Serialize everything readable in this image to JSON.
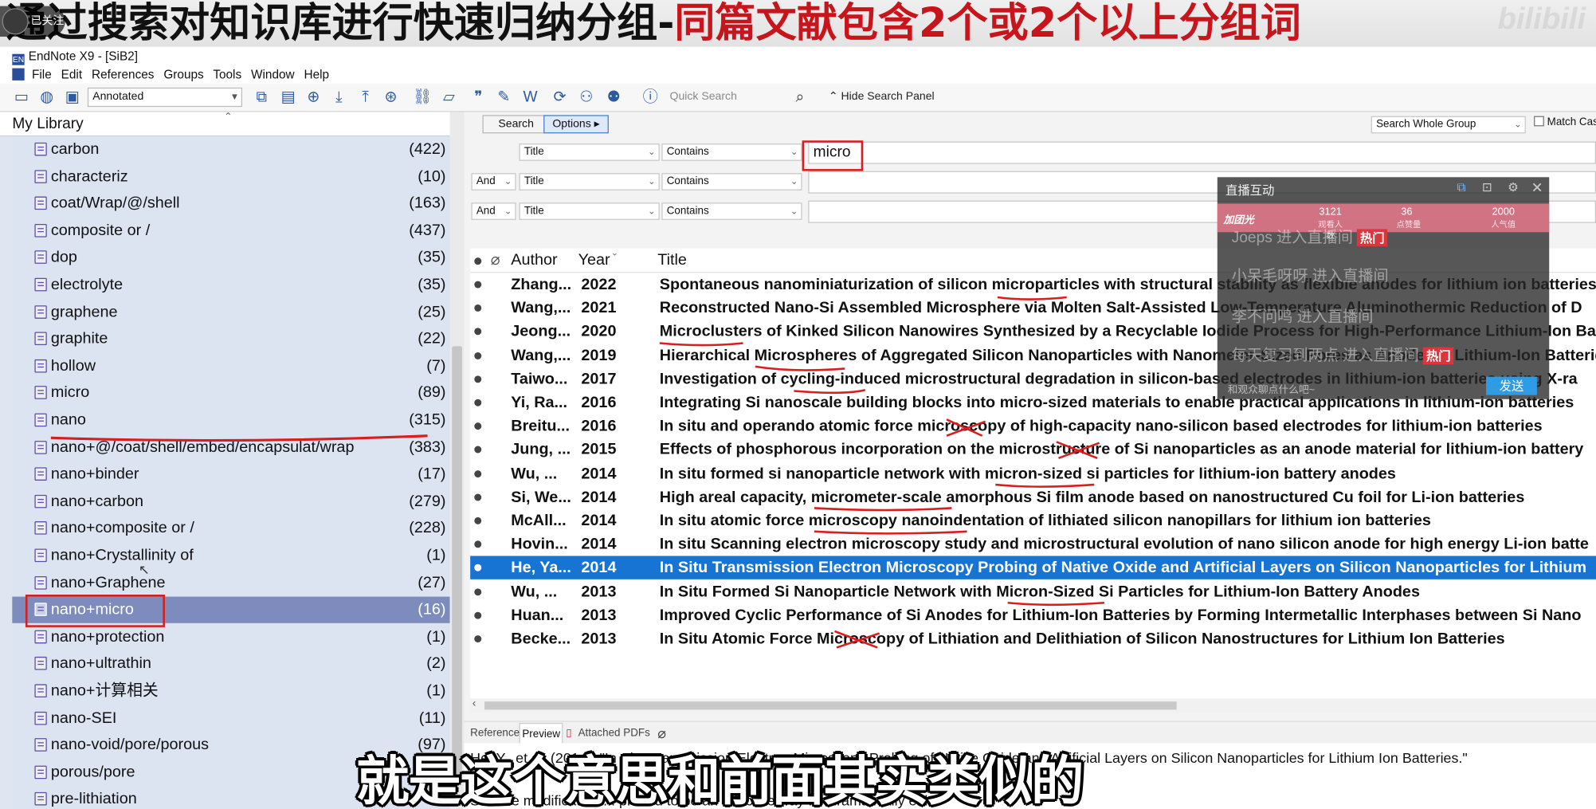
{
  "banner": {
    "title_black": "通过搜索对知识库进行快速归纳分组-",
    "title_red": "同篇文献包含2个或2个以上分组词",
    "follow_badge": "已关注",
    "watermark": "bilibili"
  },
  "window": {
    "title": "EndNote X9 - [SiB2]"
  },
  "menu": [
    "File",
    "Edit",
    "References",
    "Groups",
    "Tools",
    "Window",
    "Help"
  ],
  "toolbar": {
    "style": "Annotated",
    "quick_search_placeholder": "Quick Search",
    "hide_search_panel": "Hide Search Panel"
  },
  "library": {
    "title": "My Library",
    "groups": [
      {
        "name": "carbon",
        "count": "(422)"
      },
      {
        "name": "characteriz",
        "count": "(10)"
      },
      {
        "name": "coat/Wrap/@/shell",
        "count": "(163)"
      },
      {
        "name": "composite or /",
        "count": "(437)"
      },
      {
        "name": "dop",
        "count": "(35)"
      },
      {
        "name": "electrolyte",
        "count": "(35)"
      },
      {
        "name": "graphene",
        "count": "(25)"
      },
      {
        "name": "graphite",
        "count": "(22)"
      },
      {
        "name": "hollow",
        "count": "(7)"
      },
      {
        "name": "micro",
        "count": "(89)"
      },
      {
        "name": "nano",
        "count": "(315)"
      },
      {
        "name": "nano+@/coat/shell/embed/encapsulat/wrap",
        "count": "(383)"
      },
      {
        "name": "nano+binder",
        "count": "(17)"
      },
      {
        "name": "nano+carbon",
        "count": "(279)"
      },
      {
        "name": "nano+composite or /",
        "count": "(228)"
      },
      {
        "name": "nano+Crystallinity of",
        "count": "(1)"
      },
      {
        "name": "nano+Graphene",
        "count": "(27)"
      },
      {
        "name": "nano+micro",
        "count": "(16)"
      },
      {
        "name": "nano+protection",
        "count": "(1)"
      },
      {
        "name": "nano+ultrathin",
        "count": "(2)"
      },
      {
        "name": "nano+计算相关",
        "count": "(1)"
      },
      {
        "name": "nano-SEI",
        "count": "(11)"
      },
      {
        "name": "nano-void/pore/porous",
        "count": "(97)"
      },
      {
        "name": "porous/pore",
        "count": ""
      },
      {
        "name": "pre-lithiation",
        "count": ""
      }
    ]
  },
  "search": {
    "search_button": "Search",
    "options_button": "Options ▸",
    "scope": "Search Whole Group",
    "match_case": "Match Case",
    "rows": [
      {
        "bool": "",
        "field": "Title",
        "op": "Contains",
        "value": "micro"
      },
      {
        "bool": "And",
        "field": "Title",
        "op": "Contains",
        "value": ""
      },
      {
        "bool": "And",
        "field": "Title",
        "op": "Contains",
        "value": ""
      }
    ]
  },
  "results": {
    "columns": {
      "author": "Author",
      "year": "Year",
      "title": "Title"
    },
    "rows": [
      {
        "author": "Zhang...",
        "year": "2022",
        "title": "Spontaneous nanominiaturization of silicon microparticles with structural stability as flexible anodes for lithium ion batteries"
      },
      {
        "author": "Wang,...",
        "year": "2021",
        "title": "Reconstructed Nano-Si Assembled Microsphere via Molten Salt-Assisted Low-Temperature Aluminothermic Reduction of D"
      },
      {
        "author": "Jeong...",
        "year": "2020",
        "title": "Microclusters of Kinked Silicon Nanowires Synthesized by a Recyclable Iodide Process for High-Performance Lithium-Ion Ba"
      },
      {
        "author": "Wang,...",
        "year": "2019",
        "title": "Hierarchical Microspheres of Aggregated Silicon Nanoparticles with Nanometer-Sized Pores as Anode for Lithium-Ion Batterie"
      },
      {
        "author": "Taiwo...",
        "year": "2017",
        "title": "Investigation of cycling-induced microstructural degradation in silicon-based electrodes in lithium-ion batteries using X-ra"
      },
      {
        "author": "Yi, Ra...",
        "year": "2016",
        "title": "Integrating Si nanoscale building blocks into micro-sized materials to enable practical applications in lithium-ion batteries"
      },
      {
        "author": "Breitu...",
        "year": "2016",
        "title": "In situ and operando atomic force microscopy of high-capacity nano-silicon based electrodes for lithium-ion batteries"
      },
      {
        "author": "Jung, ...",
        "year": "2015",
        "title": "Effects of phosphorous incorporation on the microstructure of Si nanoparticles as an anode material for lithium-ion battery"
      },
      {
        "author": "Wu, ...",
        "year": "2014",
        "title": "In situ formed si nanoparticle network with micron-sized si particles for lithium-ion battery anodes"
      },
      {
        "author": "Si, We...",
        "year": "2014",
        "title": "High areal capacity, micrometer-scale amorphous Si film anode based on nanostructured Cu foil for Li-ion batteries"
      },
      {
        "author": "McAll...",
        "year": "2014",
        "title": "In situ atomic force microscopy nanoindentation of lithiated silicon nanopillars for lithium ion batteries"
      },
      {
        "author": "Hovin...",
        "year": "2014",
        "title": "In situ Scanning electron microscopy study and microstructural evolution of nano silicon anode for high energy Li-ion batte"
      },
      {
        "author": "He, Ya...",
        "year": "2014",
        "title": "In Situ Transmission Electron Microscopy Probing of Native Oxide and Artificial Layers on Silicon Nanoparticles for Lithium"
      },
      {
        "author": "Wu, ...",
        "year": "2013",
        "title": "In Situ Formed Si Nanoparticle Network with Micron-Sized Si Particles for Lithium-Ion Battery Anodes"
      },
      {
        "author": "Huan...",
        "year": "2013",
        "title": "Improved Cyclic Performance of Si Anodes for Lithium-Ion Batteries by Forming Intermetallic Interphases between Si Nano"
      },
      {
        "author": "Becke...",
        "year": "2013",
        "title": "In Situ Atomic Force Microscopy of Lithiation and Delithiation of Silicon Nanostructures for Lithium Ion Batteries"
      }
    ]
  },
  "bottom_tabs": {
    "reference": "Reference",
    "preview": "Preview",
    "attached": "Attached PDFs"
  },
  "preview": {
    "line1": "He, Y., et al. (2014). \"In Situ Transmission Electron Microscopy Probing of Native Oxide and Artificial Layers on Silicon Nanoparticles for Lithium Ion Batteries.\"",
    "line2": "Surface modification ... proved to be an effective way for dramatically enha"
  },
  "live_panel": {
    "title": "直播互动",
    "stats": [
      "3121",
      "36",
      "2000"
    ],
    "stat_labels": [
      "观看人数",
      "点赞量",
      "人气值"
    ],
    "fans_label": "加团光",
    "messages": [
      "Joeps 进入直播间",
      "小呆毛呀呀 进入直播间",
      "李不问鸣 进入直播间",
      "每天复习到两点 进入直播间"
    ],
    "hot": "热门",
    "input_hint": "和观众聊点什么吧~",
    "send": "发送"
  },
  "subtitle": "就是这个意思和前面其实类似的"
}
